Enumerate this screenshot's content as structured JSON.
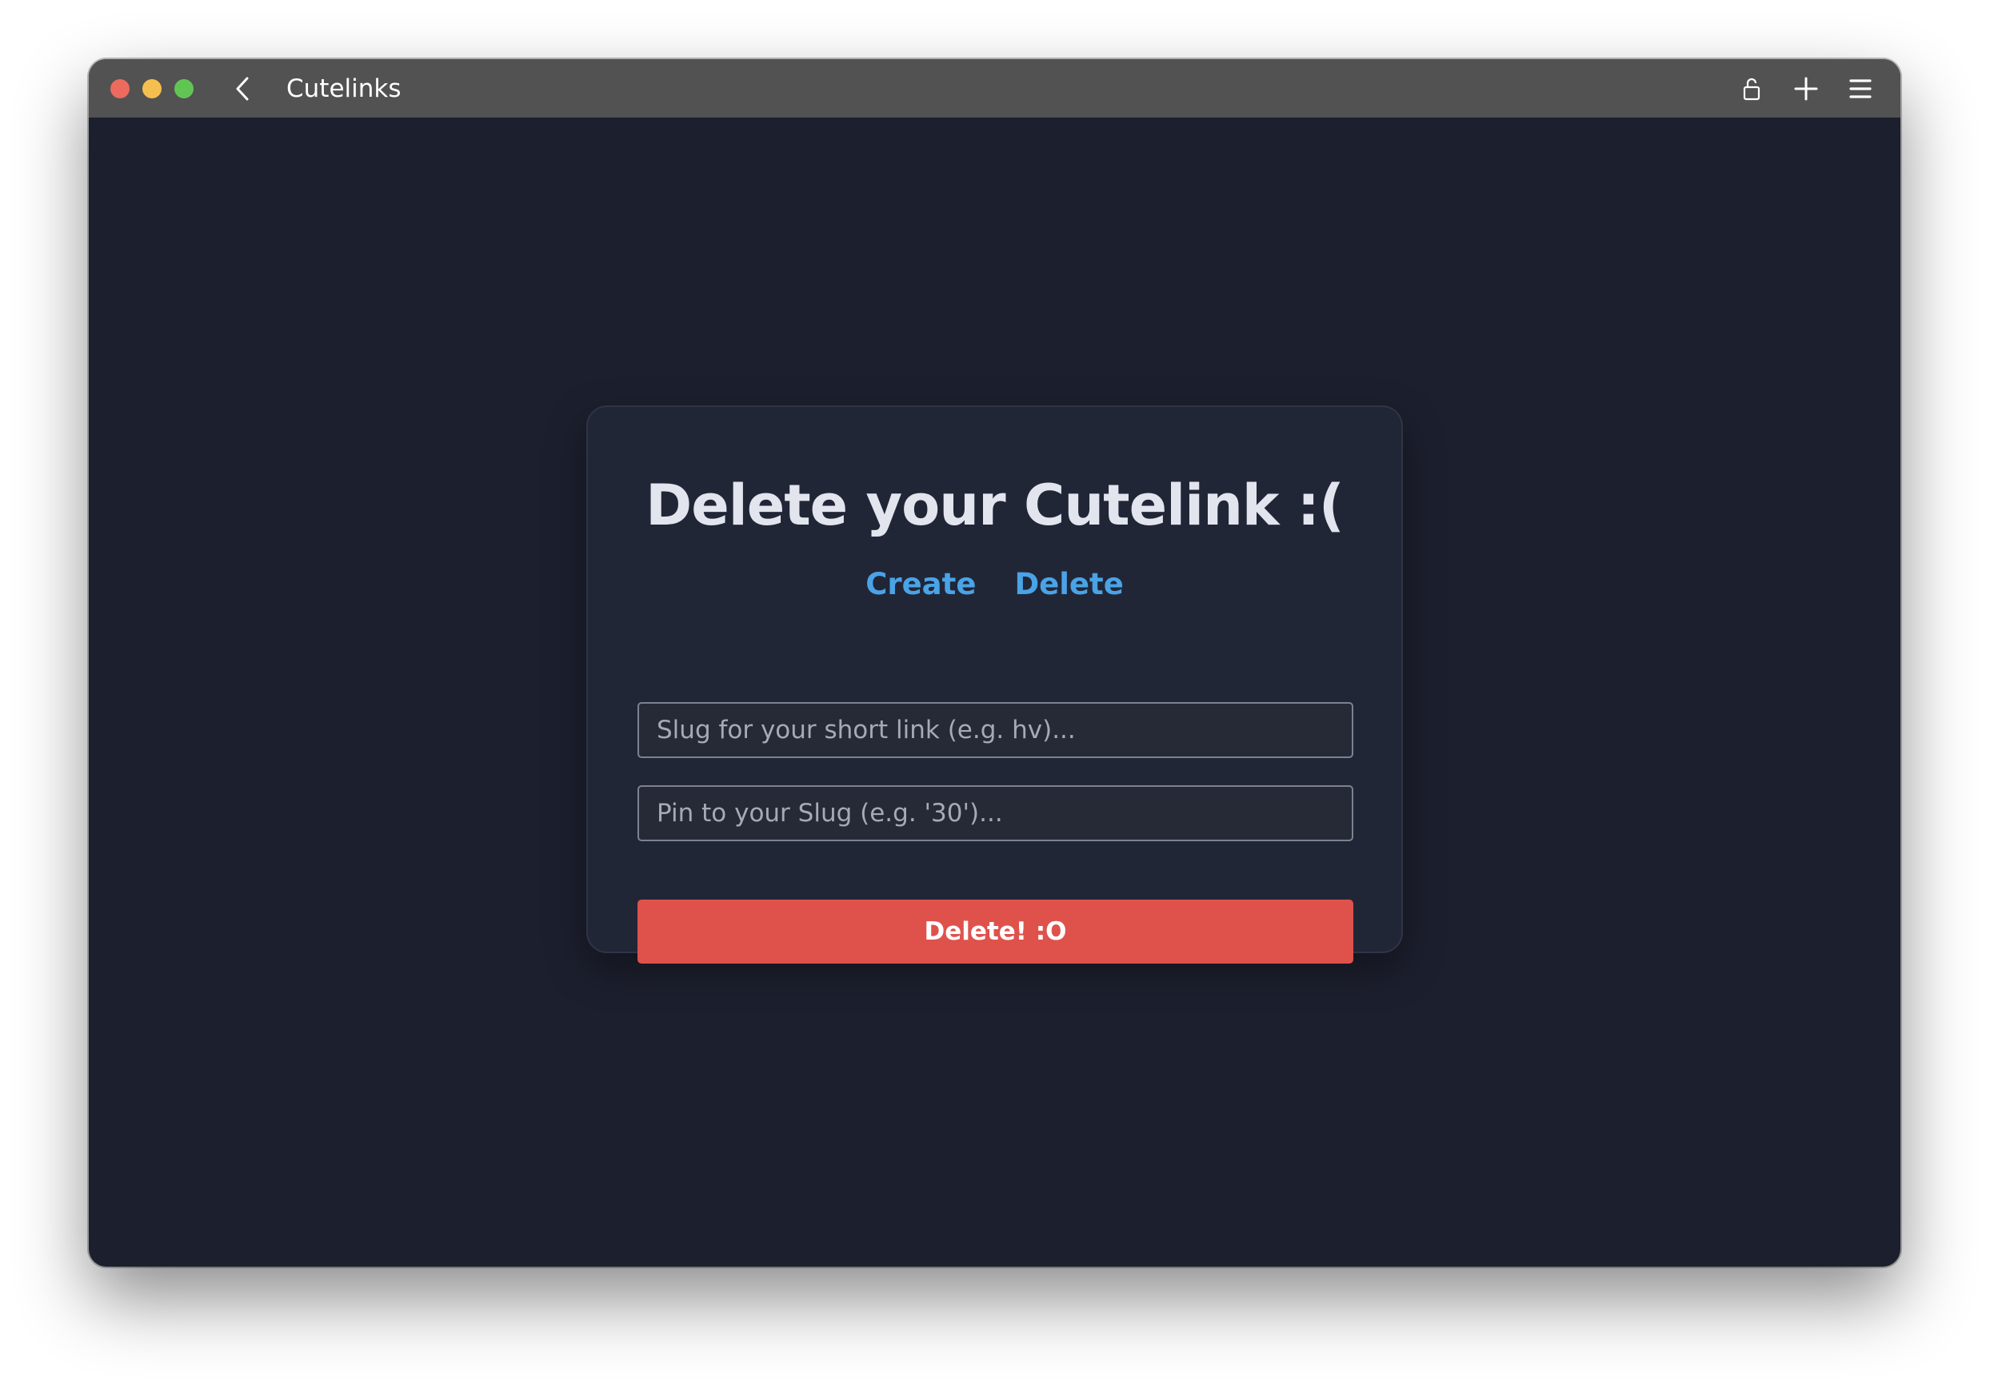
{
  "window": {
    "title": "Cutelinks"
  },
  "titlebar": {
    "icons": [
      "close-light",
      "minimize-light",
      "maximize-light",
      "chevron-left-icon",
      "unlock-icon",
      "plus-icon",
      "hamburger-menu-icon"
    ]
  },
  "card": {
    "title": "Delete your Cutelink :(",
    "nav": [
      {
        "label": "Create"
      },
      {
        "label": "Delete"
      }
    ],
    "slug_input": {
      "value": "",
      "placeholder": "Slug for your short link (e.g. hv)..."
    },
    "pin_input": {
      "value": "",
      "placeholder": "Pin to your Slug (e.g. '30')..."
    },
    "submit_label": "Delete! :O"
  },
  "colors": {
    "background": "#1c1f2d",
    "card": "#212637",
    "titlebar": "#525252",
    "link": "#4aa3e6",
    "danger": "#df524c"
  }
}
